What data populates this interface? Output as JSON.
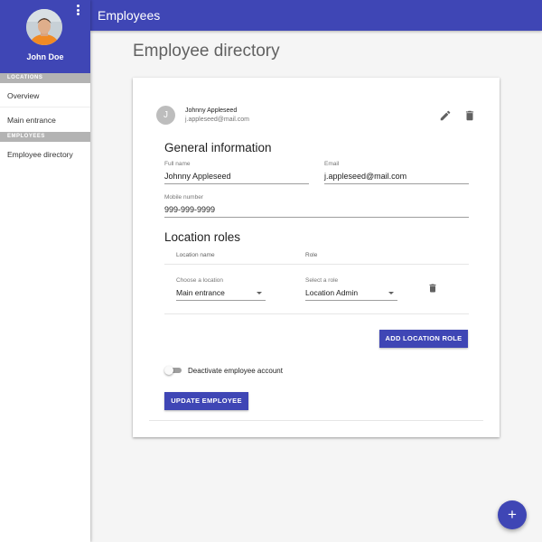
{
  "user": {
    "name": "John Doe"
  },
  "sidebar": {
    "sections": [
      {
        "title": "LOCATIONS",
        "items": [
          {
            "label": "Overview"
          },
          {
            "label": "Main entrance"
          }
        ]
      },
      {
        "title": "EMPLOYEES",
        "items": [
          {
            "label": "Employee directory"
          }
        ]
      }
    ]
  },
  "topbar": {
    "title": "Employees"
  },
  "page": {
    "title": "Employee directory"
  },
  "employee_card": {
    "avatar_initial": "J",
    "name": "Johnny Appleseed",
    "email": "j.appleseed@mail.com",
    "general": {
      "title": "General information",
      "full_name_label": "Full name",
      "full_name": "Johnny Appleseed",
      "email_label": "Email",
      "email": "j.appleseed@mail.com",
      "mobile_label": "Mobile number",
      "mobile": "999-999-9999"
    },
    "roles": {
      "title": "Location roles",
      "col_location": "Location name",
      "col_role": "Role",
      "location_label": "Choose a location",
      "location_value": "Main entrance",
      "role_label": "Select a role",
      "role_value": "Location Admin",
      "add_button": "ADD LOCATION ROLE"
    },
    "deactivate_label": "Deactivate employee account",
    "deactivate_on": false,
    "update_button": "UPDATE EMPLOYEE"
  },
  "fab": {
    "symbol": "+"
  },
  "icons": {
    "edit": "pencil-icon",
    "delete": "trash-icon",
    "more": "more-vert-icon",
    "add": "plus-icon"
  },
  "colors": {
    "primary": "#3f46b5",
    "section_header": "#b3b3b3"
  }
}
